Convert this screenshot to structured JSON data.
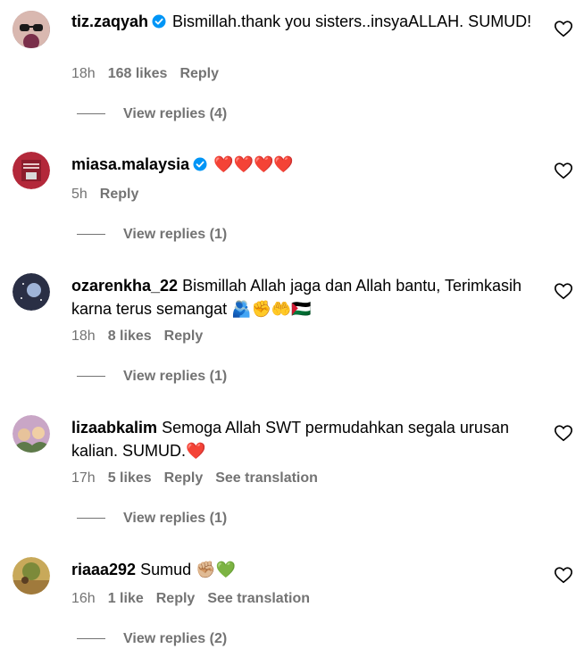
{
  "comments": [
    {
      "username": "tiz.zaqyah",
      "verified": true,
      "text": "Bismillah.thank you sisters..insyaALLAH. SUMUD!",
      "time": "18h",
      "likes": "168 likes",
      "reply_label": "Reply",
      "translation_label": "",
      "view_replies": "View replies (4)"
    },
    {
      "username": "miasa.malaysia",
      "verified": true,
      "text": "❤️❤️❤️❤️",
      "time": "5h",
      "likes": "",
      "reply_label": "Reply",
      "translation_label": "",
      "view_replies": "View replies (1)"
    },
    {
      "username": "ozarenkha_22",
      "verified": false,
      "text": "Bismillah Allah jaga dan Allah bantu, Terimkasih karna terus semangat 🫂✊🤲🇵🇸",
      "time": "18h",
      "likes": "8 likes",
      "reply_label": "Reply",
      "translation_label": "",
      "view_replies": "View replies (1)"
    },
    {
      "username": "lizaabkalim",
      "verified": false,
      "text": "Semoga Allah SWT permudahkan segala urusan kalian. SUMUD.❤️",
      "time": "17h",
      "likes": "5 likes",
      "reply_label": "Reply",
      "translation_label": "See translation",
      "view_replies": "View replies (1)"
    },
    {
      "username": "riaaa292",
      "verified": false,
      "text": "Sumud ✊🏼💚",
      "time": "16h",
      "likes": "1 like",
      "reply_label": "Reply",
      "translation_label": "See translation",
      "view_replies": "View replies (2)"
    }
  ],
  "colors": {
    "secondary_text": "#737373",
    "verified_blue": "#0095f6"
  }
}
